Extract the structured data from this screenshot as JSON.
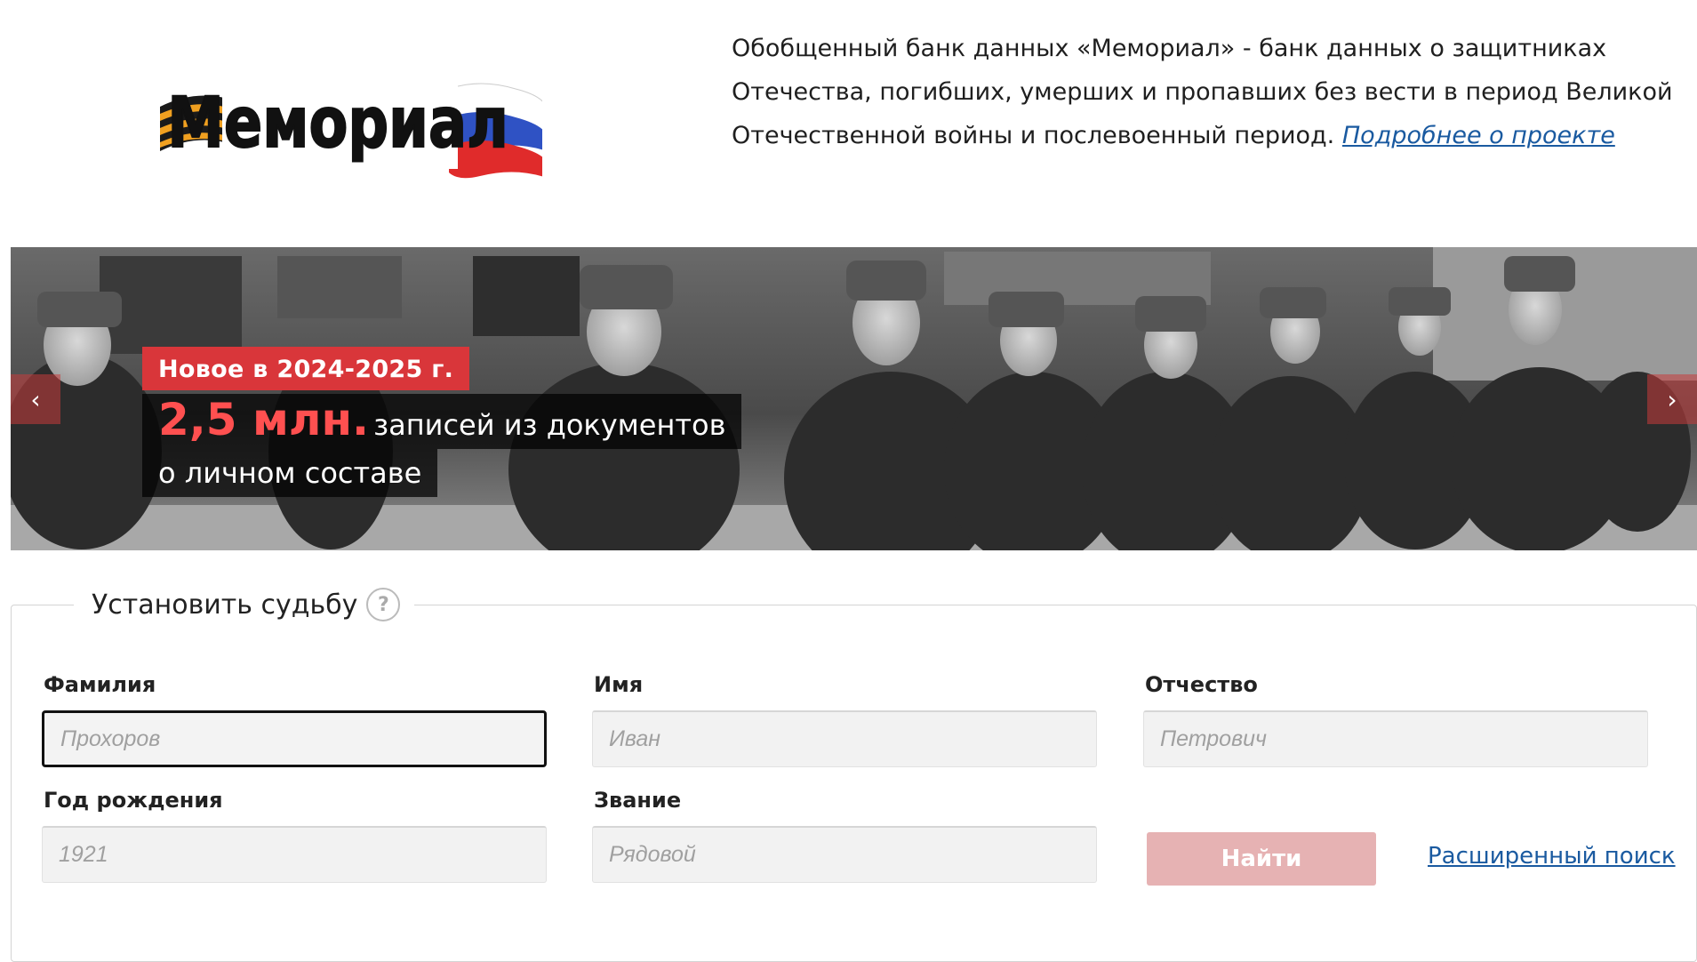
{
  "header": {
    "logo_text": "Мемориал",
    "intro_text": "Обобщенный банк данных «Мемориал» - банк данных о защитниках Отечества, погибших, умерших и пропавших без вести в период Великой Отечественной войны и послевоенный период.",
    "more_link": "Подробнее о проекте"
  },
  "banner": {
    "badge": "Новое в 2024-2025 г.",
    "highlight": "2,5 млн.",
    "line1_rest": "записей из документов",
    "line2": "о личном составе",
    "prev_arrow": "‹",
    "next_arrow": "›"
  },
  "search": {
    "title": "Установить судьбу",
    "help": "?",
    "fields": {
      "surname": {
        "label": "Фамилия",
        "placeholder": "Прохоров"
      },
      "name": {
        "label": "Имя",
        "placeholder": "Иван"
      },
      "patronymic": {
        "label": "Отчество",
        "placeholder": "Петрович"
      },
      "birth_year": {
        "label": "Год рождения",
        "placeholder": "1921"
      },
      "rank": {
        "label": "Звание",
        "placeholder": "Рядовой"
      }
    },
    "find_button": "Найти",
    "advanced_link": "Расширенный поиск"
  },
  "colors": {
    "accent_red": "#d9363a",
    "link_blue": "#1a5aa0",
    "find_button_disabled": "#e6b2b3"
  }
}
